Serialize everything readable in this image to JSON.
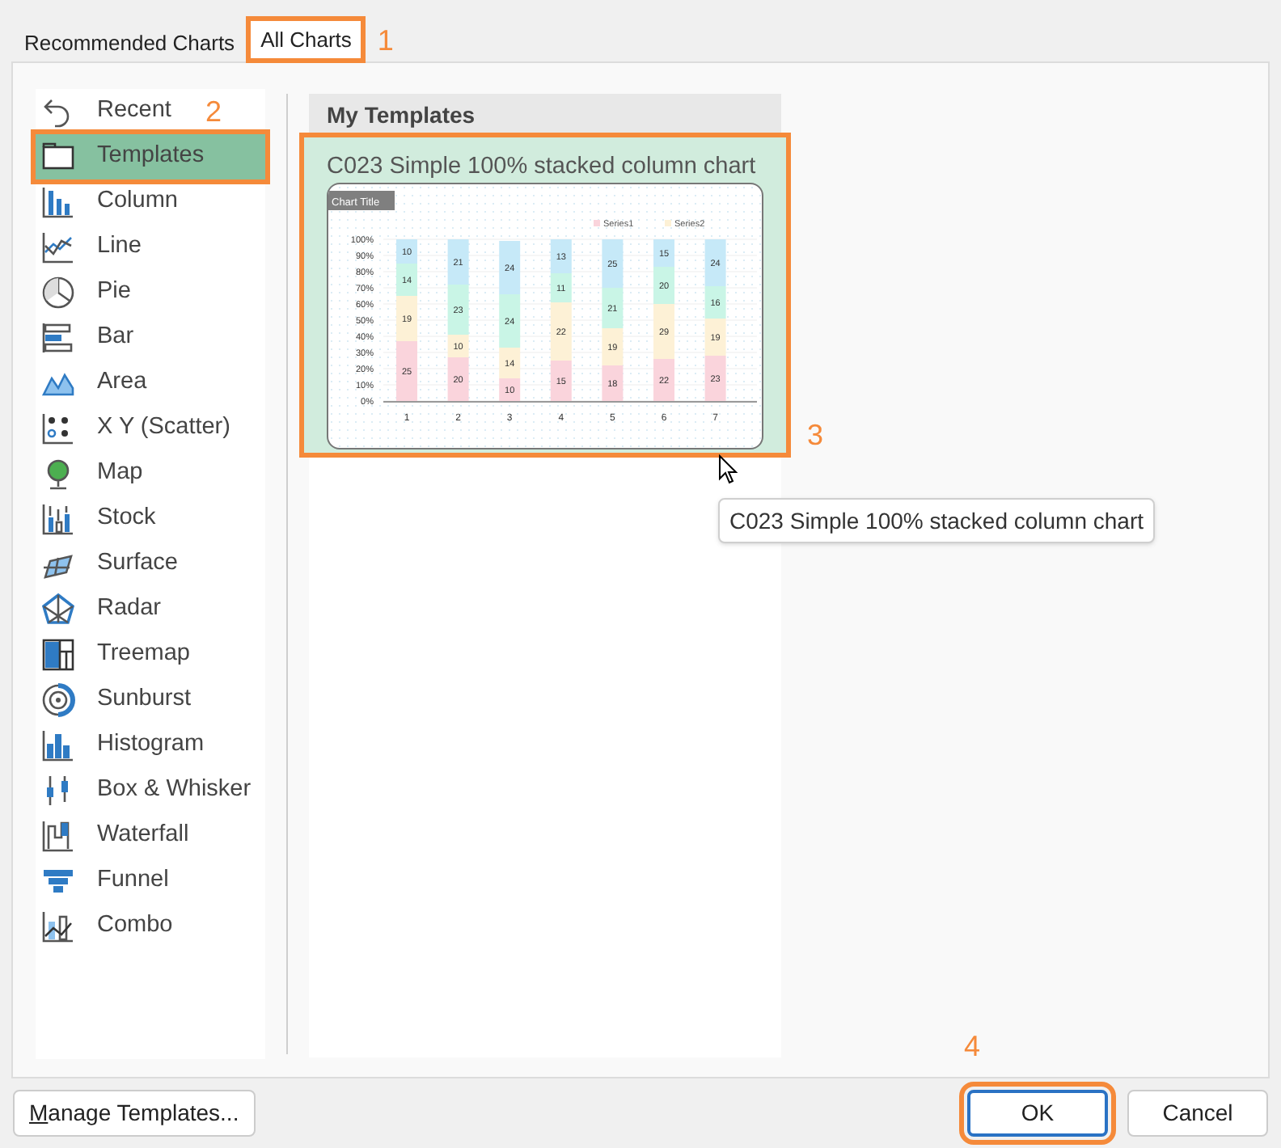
{
  "tabs": [
    {
      "label": "Recommended Charts",
      "selected": false,
      "highlighted": false
    },
    {
      "label": "All Charts",
      "selected": true,
      "highlighted": true,
      "callout": "1"
    }
  ],
  "chart_types": [
    {
      "label": "Recent",
      "selected": false,
      "highlighted": false,
      "callout": "2"
    },
    {
      "label": "Templates",
      "selected": true,
      "highlighted": true
    },
    {
      "label": "Column",
      "selected": false,
      "highlighted": false
    },
    {
      "label": "Line",
      "selected": false,
      "highlighted": false
    },
    {
      "label": "Pie",
      "selected": false,
      "highlighted": false
    },
    {
      "label": "Bar",
      "selected": false,
      "highlighted": false
    },
    {
      "label": "Area",
      "selected": false,
      "highlighted": false
    },
    {
      "label": "X Y (Scatter)",
      "selected": false,
      "highlighted": false
    },
    {
      "label": "Map",
      "selected": false,
      "highlighted": false
    },
    {
      "label": "Stock",
      "selected": false,
      "highlighted": false
    },
    {
      "label": "Surface",
      "selected": false,
      "highlighted": false
    },
    {
      "label": "Radar",
      "selected": false,
      "highlighted": false
    },
    {
      "label": "Treemap",
      "selected": false,
      "highlighted": false
    },
    {
      "label": "Sunburst",
      "selected": false,
      "highlighted": false
    },
    {
      "label": "Histogram",
      "selected": false,
      "highlighted": false
    },
    {
      "label": "Box & Whisker",
      "selected": false,
      "highlighted": false
    },
    {
      "label": "Waterfall",
      "selected": false,
      "highlighted": false
    },
    {
      "label": "Funnel",
      "selected": false,
      "highlighted": false
    },
    {
      "label": "Combo",
      "selected": false,
      "highlighted": false
    }
  ],
  "templates": {
    "heading": "My Templates",
    "items": [
      {
        "title": "C023 Simple 100% stacked column chart",
        "selected": true,
        "highlighted": true,
        "callout": "3",
        "chart_data": {
          "type": "bar",
          "title": "Chart Title",
          "stacked": true,
          "categories": [
            "1",
            "2",
            "3",
            "4",
            "5",
            "6",
            "7"
          ],
          "yticks": [
            {
              "value": 0,
              "label": "0%"
            },
            {
              "value": 0.1,
              "label": "10%"
            },
            {
              "value": 0.2,
              "label": "20%"
            },
            {
              "value": 0.3,
              "label": "30%"
            },
            {
              "value": 0.4,
              "label": "40%"
            },
            {
              "value": 0.5,
              "label": "50%"
            },
            {
              "value": 0.6,
              "label": "60%"
            },
            {
              "value": 0.7,
              "label": "70%"
            },
            {
              "value": 0.8,
              "label": "80%"
            },
            {
              "value": 0.9,
              "label": "90%"
            },
            {
              "value": 1,
              "label": "100%"
            }
          ],
          "ylim": [
            0,
            1
          ],
          "grid": true,
          "legend": "top right",
          "series": [
            {
              "name": "Series1",
              "color": "#fad4dc",
              "values": [
                0.37,
                0.27,
                0.14,
                0.25,
                0.22,
                0.26,
                0.28
              ]
            },
            {
              "name": "Series2",
              "color": "#fdf1d6",
              "values": [
                0.28,
                0.14,
                0.19,
                0.36,
                0.23,
                0.34,
                0.23
              ]
            },
            {
              "color": "#c9f5e6",
              "values": [
                0.2,
                0.31,
                0.33,
                0.18,
                0.25,
                0.23,
                0.2
              ]
            },
            {
              "color": "#c6e9f8",
              "values": [
                0.15,
                0.28,
                0.33,
                0.21,
                0.3,
                0.17,
                0.29
              ]
            }
          ],
          "annotations": [
            "25",
            "19",
            "14",
            "10",
            "20",
            "10",
            "23",
            "21",
            "10",
            "14",
            "24",
            "24",
            "15",
            "22",
            "11",
            "13",
            "18",
            "19",
            "21",
            "25",
            "22",
            "29",
            "20",
            "15",
            "23",
            "19",
            "16",
            "24"
          ]
        }
      }
    ]
  },
  "tooltip": "C023 Simple 100% stacked column chart",
  "buttons": [
    {
      "label": "Manage Templates...",
      "highlighted": false
    },
    {
      "label": "OK",
      "highlighted": true,
      "callout": "4"
    },
    {
      "label": "Cancel",
      "highlighted": false
    }
  ]
}
